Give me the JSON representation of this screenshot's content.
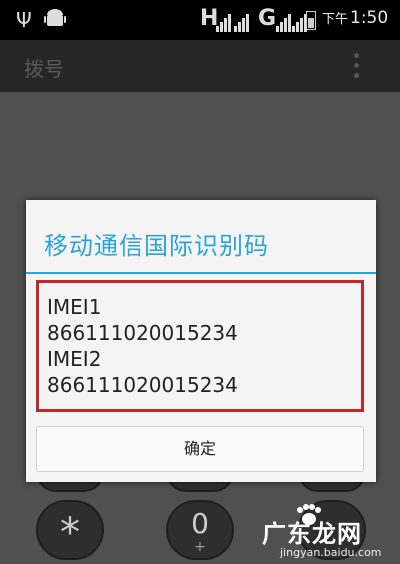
{
  "statusbar": {
    "network1": "H",
    "network2": "G",
    "ampm": "下午",
    "time": "1:50"
  },
  "actionbar": {
    "title": "拨号",
    "menu_icon": "overflow-menu-icon"
  },
  "dialog": {
    "title": "移动通信国际识别码",
    "lines": [
      "IMEI1",
      "866111020015234",
      "IMEI2",
      "866111020015234"
    ],
    "ok_label": "确定",
    "accent": "#29a3d8",
    "highlight_border": "#c0282b"
  },
  "dialpad": {
    "star": "*",
    "zero": "0",
    "zero_sub": "+"
  },
  "watermark": {
    "text": "广东龙网",
    "sub": "jingyan.baidu.com"
  }
}
